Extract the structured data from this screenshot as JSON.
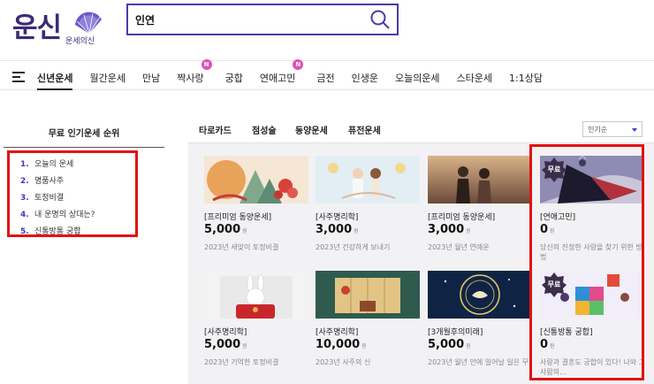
{
  "header": {
    "logo_text": "운신",
    "logo_sub": "운세의신",
    "search_value": "인연"
  },
  "nav": {
    "items": [
      {
        "label": "신년운세",
        "badge": ""
      },
      {
        "label": "월간운세",
        "badge": ""
      },
      {
        "label": "만남",
        "badge": ""
      },
      {
        "label": "짝사랑",
        "badge": "N"
      },
      {
        "label": "궁합",
        "badge": ""
      },
      {
        "label": "연애고민",
        "badge": "N"
      },
      {
        "label": "금전",
        "badge": ""
      },
      {
        "label": "인생운",
        "badge": ""
      },
      {
        "label": "오늘의운세",
        "badge": ""
      },
      {
        "label": "스타운세",
        "badge": ""
      },
      {
        "label": "1:1상담",
        "badge": ""
      }
    ]
  },
  "ranking": {
    "title": "무료 인기운세 순위",
    "items": [
      {
        "num": "1.",
        "label": "오늘의 운세"
      },
      {
        "num": "2.",
        "label": "명품사주"
      },
      {
        "num": "3.",
        "label": "토정비결"
      },
      {
        "num": "4.",
        "label": "내 운명의 상대는?"
      },
      {
        "num": "5.",
        "label": "신통방통 궁합"
      }
    ]
  },
  "tabs": [
    "타로카드",
    "점성술",
    "동양운세",
    "퓨전운세"
  ],
  "sort": {
    "selected": "인기순"
  },
  "price_unit": "원",
  "free_label": "무료",
  "products": [
    {
      "title": "[프리미엄 동양운세]",
      "price": "5,000",
      "desc": "2023년 새맞이 토정비결",
      "free": false
    },
    {
      "title": "[사주명리학]",
      "price": "3,000",
      "desc": "2023년 건강하게 보내기",
      "free": false
    },
    {
      "title": "[프리미엄 동양운세]",
      "price": "3,000",
      "desc": "2023년 월년 연애운",
      "free": false
    },
    {
      "title": "[연애고민]",
      "price": "0",
      "desc": "당신의 진정한 사랑을 찾기 위한 방법",
      "free": true
    },
    {
      "title": "[사주명리학]",
      "price": "5,000",
      "desc": "2023년 기억한 토정비결",
      "free": false
    },
    {
      "title": "[사주명리학]",
      "price": "10,000",
      "desc": "2023년 사주의 신",
      "free": false
    },
    {
      "title": "[3개월후의미래]",
      "price": "5,000",
      "desc": "2023년 월년 안에 일어날 일은 무",
      "free": false
    },
    {
      "title": "[신통방통 궁합]",
      "price": "0",
      "desc": "사랑과 결혼도 궁합이 있다! 나와 그사람의...",
      "free": true
    }
  ],
  "colors": {
    "brand": "#3a2a78",
    "accent": "#4b3aa8",
    "badge": "#e34fb7",
    "highlight": "#e31212"
  }
}
